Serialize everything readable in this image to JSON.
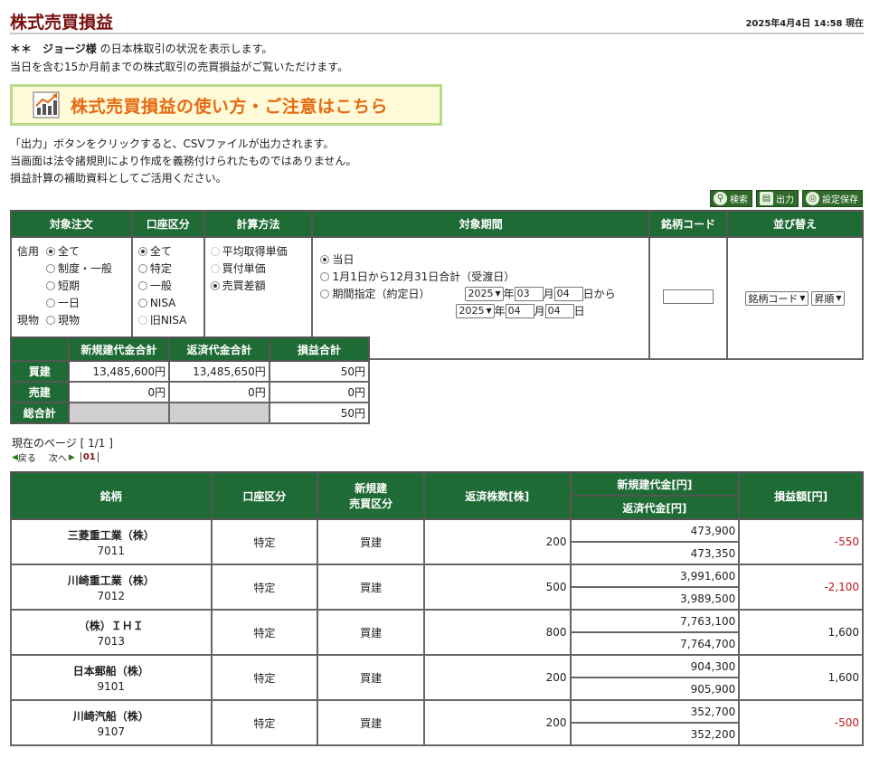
{
  "header": {
    "title": "株式売買損益",
    "timestamp": "2025年4月4日 14:58 現在"
  },
  "intro": {
    "line1_prefix": "＊＊　ジョージ様",
    "line1_suffix": " の日本株取引の状況を表示します。",
    "line2": "当日を含む15か月前までの株式取引の売買損益がご覧いただけます。"
  },
  "guide_banner": {
    "label": "株式売買損益の使い方・ご注意はこちら",
    "icon": "chart-icon"
  },
  "notes": [
    "「出力」ボタンをクリックすると、CSVファイルが出力されます。",
    "当画面は法令諸規則により作成を義務付けられたものではありません。",
    "損益計算の補助資料としてご活用ください。"
  ],
  "toolbar": {
    "search": "検索",
    "output": "出力",
    "save_settings": "設定保存"
  },
  "filter": {
    "headers": [
      "対象注文",
      "口座区分",
      "計算方法",
      "対象期間",
      "銘柄コード",
      "並び替え"
    ],
    "order": {
      "credit_label": "信用",
      "cash_label": "現物",
      "credit_options": [
        "全て",
        "制度・一般",
        "短期",
        "一日"
      ],
      "cash_option": "現物",
      "selected": "全て"
    },
    "account": {
      "options": [
        "全て",
        "特定",
        "一般",
        "NISA",
        "旧NISA"
      ],
      "selected": "全て"
    },
    "calc": {
      "options": [
        "平均取得単価",
        "買付単価",
        "売買差額"
      ],
      "selected": "売買差額"
    },
    "period": {
      "opt_today": "当日",
      "opt_year": "1月1日から12月31日合計（受渡日）",
      "opt_range": "期間指定（約定日）",
      "selected": "当日",
      "from": {
        "year": "2025",
        "month": "03",
        "day": "04",
        "suffix": "日から"
      },
      "to": {
        "year": "2025",
        "month": "04",
        "day": "04",
        "suffix": "日"
      },
      "year_unit": "年",
      "month_unit": "月"
    },
    "code_value": "",
    "sort": {
      "field": "銘柄コード",
      "order": "昇順"
    }
  },
  "summary": {
    "headers": [
      "新規建代金合計",
      "返済代金合計",
      "損益合計"
    ],
    "rows": [
      {
        "label": "買建",
        "new": "13,485,600円",
        "repay": "13,485,650円",
        "pl": "50円"
      },
      {
        "label": "売建",
        "new": "0円",
        "repay": "0円",
        "pl": "0円"
      },
      {
        "label": "総合計",
        "pl": "50円"
      }
    ]
  },
  "pager": {
    "current": "現在のページ [ 1/1 ]",
    "prev": "戻る",
    "next": "次へ",
    "page": "01"
  },
  "positions": {
    "headers": {
      "name": "銘柄",
      "account": "口座区分",
      "side_1": "新規建",
      "side_2": "売買区分",
      "qty": "返済株数[株]",
      "new_amount": "新規建代金[円]",
      "repay_amount": "返済代金[円]",
      "pl": "損益額[円]"
    },
    "rows": [
      {
        "name": "三菱重工業（株）",
        "code": "7011",
        "account": "特定",
        "side": "買建",
        "qty": "200",
        "new_amount": "473,900",
        "repay_amount": "473,350",
        "pl": "-550",
        "negative": true
      },
      {
        "name": "川崎重工業（株）",
        "code": "7012",
        "account": "特定",
        "side": "買建",
        "qty": "500",
        "new_amount": "3,991,600",
        "repay_amount": "3,989,500",
        "pl": "-2,100",
        "negative": true
      },
      {
        "name": "（株）ＩＨＩ",
        "code": "7013",
        "account": "特定",
        "side": "買建",
        "qty": "800",
        "new_amount": "7,763,100",
        "repay_amount": "7,764,700",
        "pl": "1,600",
        "negative": false
      },
      {
        "name": "日本郵船（株）",
        "code": "9101",
        "account": "特定",
        "side": "買建",
        "qty": "200",
        "new_amount": "904,300",
        "repay_amount": "905,900",
        "pl": "1,600",
        "negative": false
      },
      {
        "name": "川崎汽船（株）",
        "code": "9107",
        "account": "特定",
        "side": "買建",
        "qty": "200",
        "new_amount": "352,700",
        "repay_amount": "352,200",
        "pl": "-500",
        "negative": true
      }
    ]
  }
}
